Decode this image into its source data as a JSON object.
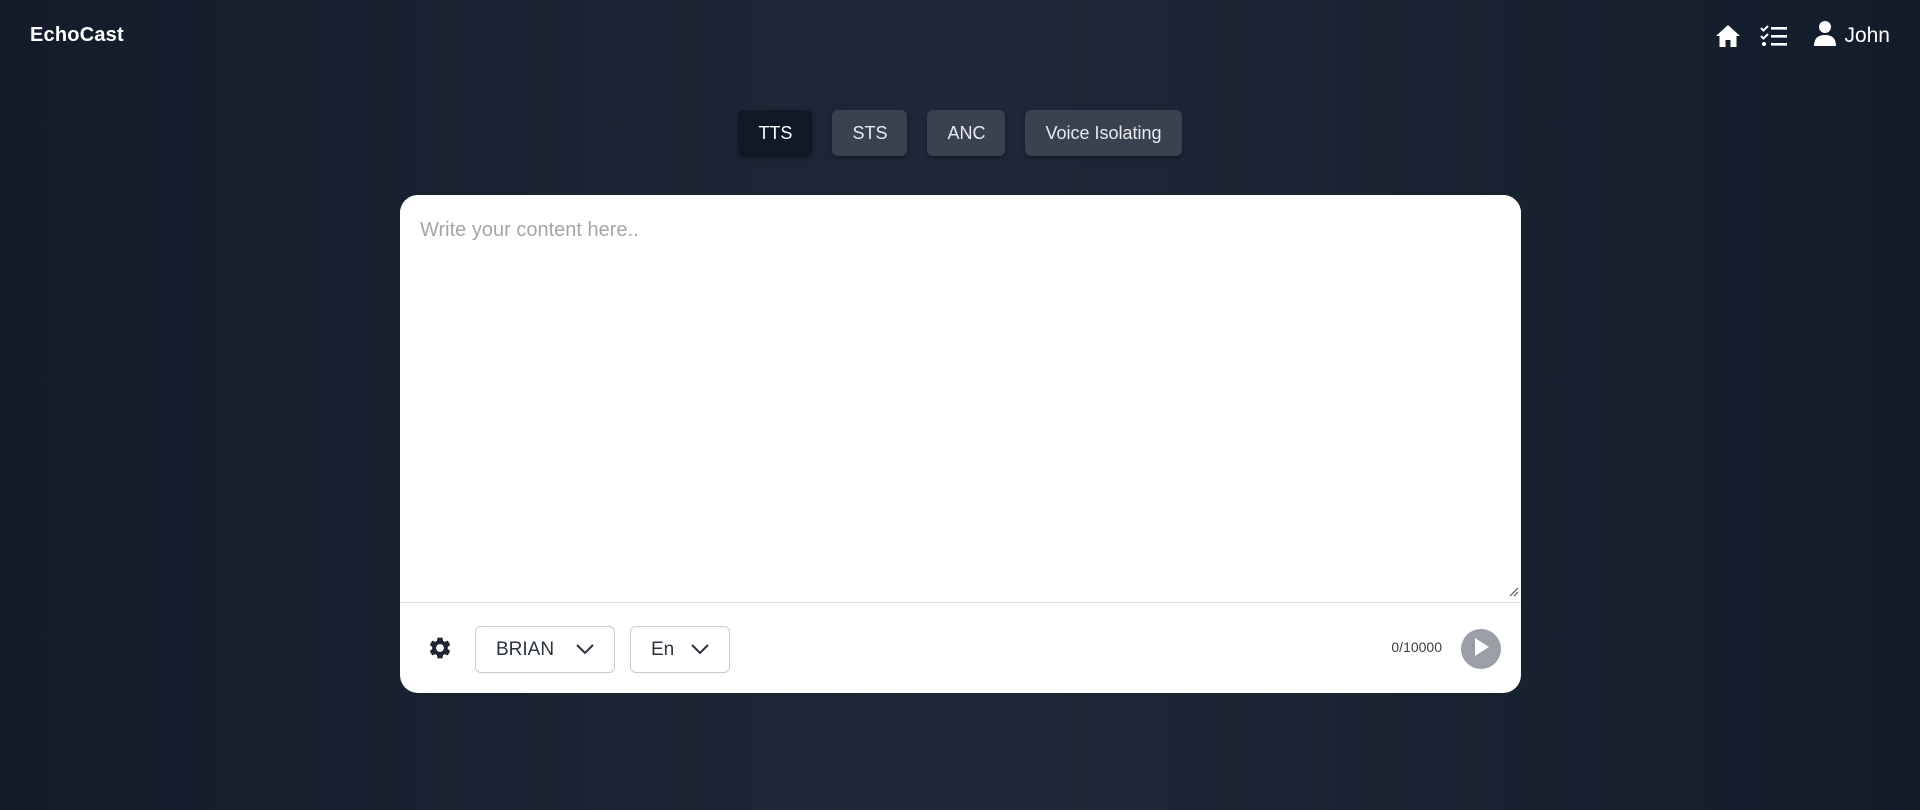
{
  "header": {
    "brand": "EchoCast",
    "icons": [
      "home-icon",
      "checklist-icon",
      "user-icon"
    ],
    "user_name": "John"
  },
  "tabs": [
    {
      "label": "TTS",
      "active": true
    },
    {
      "label": "STS",
      "active": false
    },
    {
      "label": "ANC",
      "active": false
    },
    {
      "label": "Voice Isolating",
      "active": false
    }
  ],
  "editor": {
    "placeholder": "Write your content here..",
    "value": ""
  },
  "footer": {
    "settings_icon": "gear-icon",
    "voice_select": "BRIAN",
    "language_select": "En",
    "char_counter": "0/10000",
    "play_icon": "play-icon"
  },
  "colors": {
    "background": "#1a2230",
    "tab_bg": "#3a4252",
    "tab_active_bg": "#101725",
    "card_bg": "#ffffff",
    "play_bg": "#9a9ea6"
  }
}
